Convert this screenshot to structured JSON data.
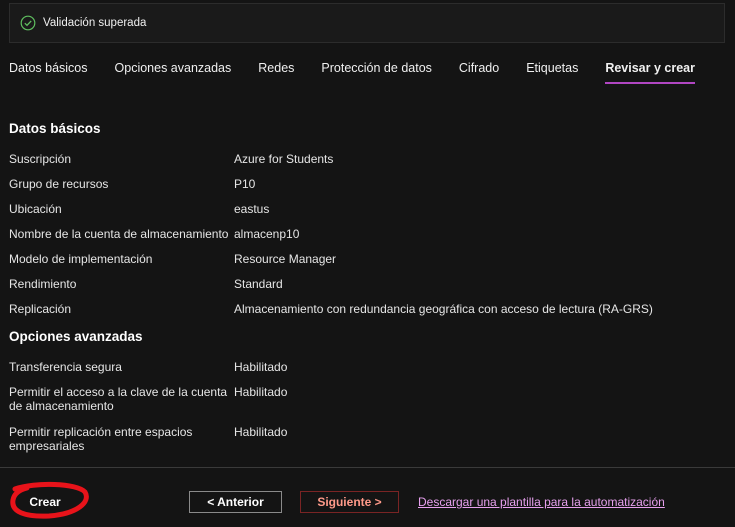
{
  "validation": {
    "text": "Validación superada",
    "icon": "check-circle-icon",
    "color": "#5fbf5f"
  },
  "tabs": [
    {
      "label": "Datos básicos",
      "active": false
    },
    {
      "label": "Opciones avanzadas",
      "active": false
    },
    {
      "label": "Redes",
      "active": false
    },
    {
      "label": "Protección de datos",
      "active": false
    },
    {
      "label": "Cifrado",
      "active": false
    },
    {
      "label": "Etiquetas",
      "active": false
    },
    {
      "label": "Revisar y crear",
      "active": true
    }
  ],
  "basics": {
    "title": "Datos básicos",
    "rows": [
      {
        "label": "Suscripción",
        "value": "Azure for Students"
      },
      {
        "label": "Grupo de recursos",
        "value": "P10"
      },
      {
        "label": "Ubicación",
        "value": "eastus"
      },
      {
        "label": "Nombre de la cuenta de almacenamiento",
        "value": "almacenp10"
      },
      {
        "label": "Modelo de implementación",
        "value": "Resource Manager"
      },
      {
        "label": "Rendimiento",
        "value": "Standard"
      },
      {
        "label": "Replicación",
        "value": "Almacenamiento con redundancia geográfica con acceso de lectura (RA-GRS)"
      }
    ]
  },
  "advanced": {
    "title": "Opciones avanzadas",
    "rows": [
      {
        "label": "Transferencia segura",
        "value": "Habilitado"
      },
      {
        "label": "Permitir el acceso a la clave de la cuenta de almacenamiento",
        "value": "Habilitado"
      },
      {
        "label": "Permitir replicación entre espacios empresariales",
        "value": "Habilitado"
      }
    ]
  },
  "footer": {
    "create_label": "Crear",
    "prev_label": "< Anterior",
    "next_label": "Siguiente >",
    "template_link": "Descargar una plantilla para la automatización"
  },
  "colors": {
    "accent": "#b146c2",
    "link": "#e7a0ee",
    "annotation": "#e8131a"
  }
}
